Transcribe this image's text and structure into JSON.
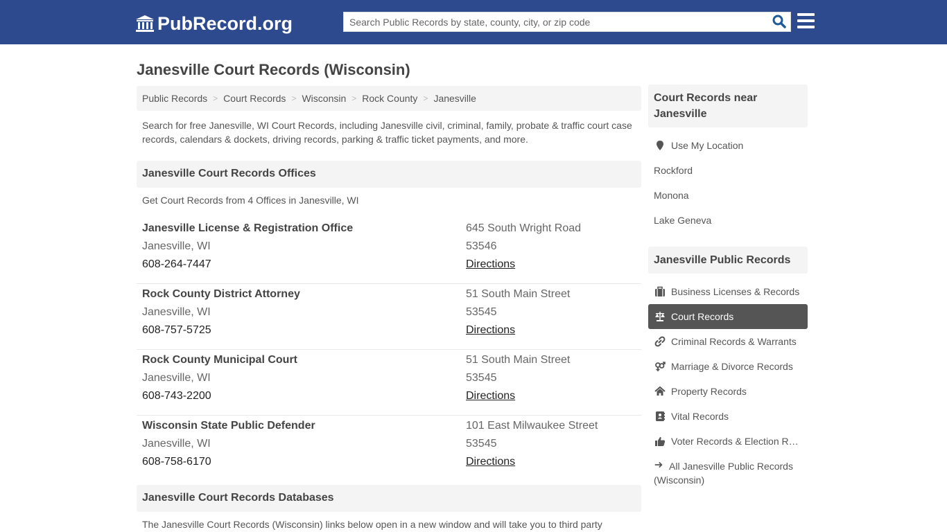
{
  "header": {
    "logo_text": "PubRecord.org",
    "search_placeholder": "Search Public Records by state, county, city, or zip code",
    "search_value": "",
    "search_icon": "search-icon",
    "menu_icon": "hamburger-menu-icon",
    "brand_color": "#2e4a8f"
  },
  "page": {
    "title": "Janesville Court Records (Wisconsin)",
    "breadcrumb": [
      "Public Records",
      "Court Records",
      "Wisconsin",
      "Rock County",
      "Janesville"
    ],
    "intro": "Search for free Janesville, WI Court Records, including Janesville civil, criminal, family, probate & traffic court case records, calendars & dockets, driving records, parking & traffic ticket payments, and more."
  },
  "offices": {
    "heading": "Janesville Court Records Offices",
    "subtext": "Get Court Records from 4 Offices in Janesville, WI",
    "items": [
      {
        "name": "Janesville License & Registration Office",
        "city": "Janesville, WI",
        "phone": "608-264-7447",
        "address": "645 South Wright Road",
        "zip": "53546",
        "directions": "Directions"
      },
      {
        "name": "Rock County District Attorney",
        "city": "Janesville, WI",
        "phone": "608-757-5725",
        "address": "51 South Main Street",
        "zip": "53545",
        "directions": "Directions"
      },
      {
        "name": "Rock County Municipal Court",
        "city": "Janesville, WI",
        "phone": "608-743-2200",
        "address": "51 South Main Street",
        "zip": "53545",
        "directions": "Directions"
      },
      {
        "name": "Wisconsin State Public Defender",
        "city": "Janesville, WI",
        "phone": "608-758-6170",
        "address": "101 East Milwaukee Street",
        "zip": "53545",
        "directions": "Directions"
      }
    ]
  },
  "databases": {
    "heading": "Janesville Court Records Databases",
    "text": "The Janesville Court Records (Wisconsin) links below open in a new window and will take you to third party"
  },
  "sidebar": {
    "nearby_heading": "Court Records near Janesville",
    "use_location": "Use My Location",
    "nearby": [
      "Rockford",
      "Monona",
      "Lake Geneva"
    ],
    "public_heading": "Janesville Public Records",
    "public_items": [
      {
        "label": "Business Licenses & Records",
        "icon": "briefcase-icon",
        "active": false
      },
      {
        "label": "Court Records",
        "icon": "scales-icon",
        "active": true
      },
      {
        "label": "Criminal Records & Warrants",
        "icon": "link-icon",
        "active": false
      },
      {
        "label": "Marriage & Divorce Records",
        "icon": "gender-icon",
        "active": false
      },
      {
        "label": "Property Records",
        "icon": "home-icon",
        "active": false
      },
      {
        "label": "Vital Records",
        "icon": "address-book-icon",
        "active": false
      },
      {
        "label": "Voter Records & Election Results",
        "icon": "thumbs-up-icon",
        "active": false
      }
    ],
    "all_records": "All Janesville Public Records (Wisconsin)",
    "active_color": "#555555"
  }
}
